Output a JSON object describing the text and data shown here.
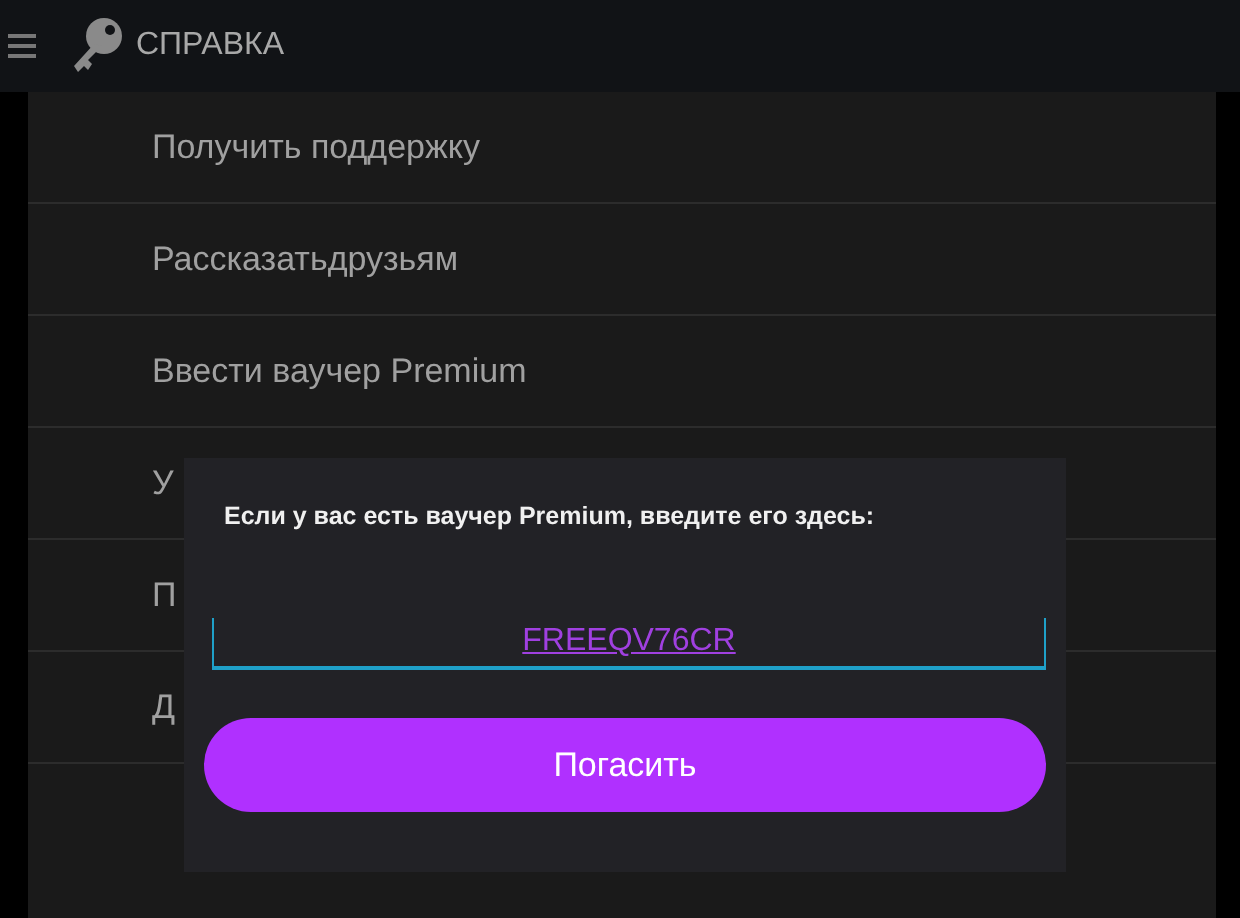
{
  "header": {
    "title": "СПРАВКА"
  },
  "menu": [
    {
      "label": "Получить поддержку"
    },
    {
      "label": "Рассказатьдрузьям"
    },
    {
      "label": "Ввести ваучер Premium"
    },
    {
      "label": "У"
    },
    {
      "label": "П"
    },
    {
      "label": "Д"
    }
  ],
  "dialog": {
    "message": "Если у вас есть ваучер Premium, введите его здесь:",
    "voucher": {
      "value": "FREEQV76CR"
    },
    "button": "Погасить"
  }
}
